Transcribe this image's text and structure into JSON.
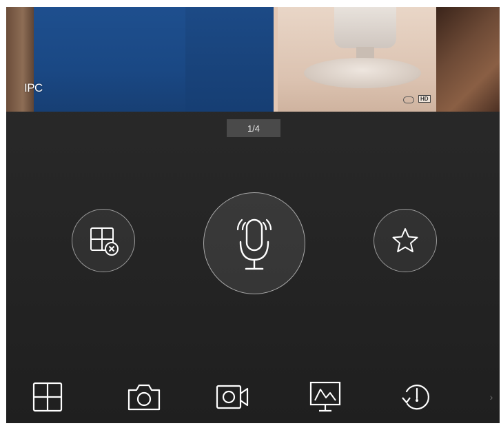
{
  "video": {
    "channel_label": "IPC",
    "hd_badge": "HD"
  },
  "pager": {
    "indicator": "1/4"
  },
  "controls": {
    "close_split": "grid-close-icon",
    "talk": "microphone-icon",
    "favorite": "star-icon"
  },
  "toolbar": {
    "icons": [
      "grid-layout-icon",
      "camera-icon",
      "video-record-icon",
      "monitor-chart-icon",
      "playback-clock-icon"
    ],
    "more_glyph": "›"
  },
  "colors": {
    "background": "#262626",
    "icon_stroke": "#ffffff",
    "circle_border": "#9c9c9c"
  }
}
